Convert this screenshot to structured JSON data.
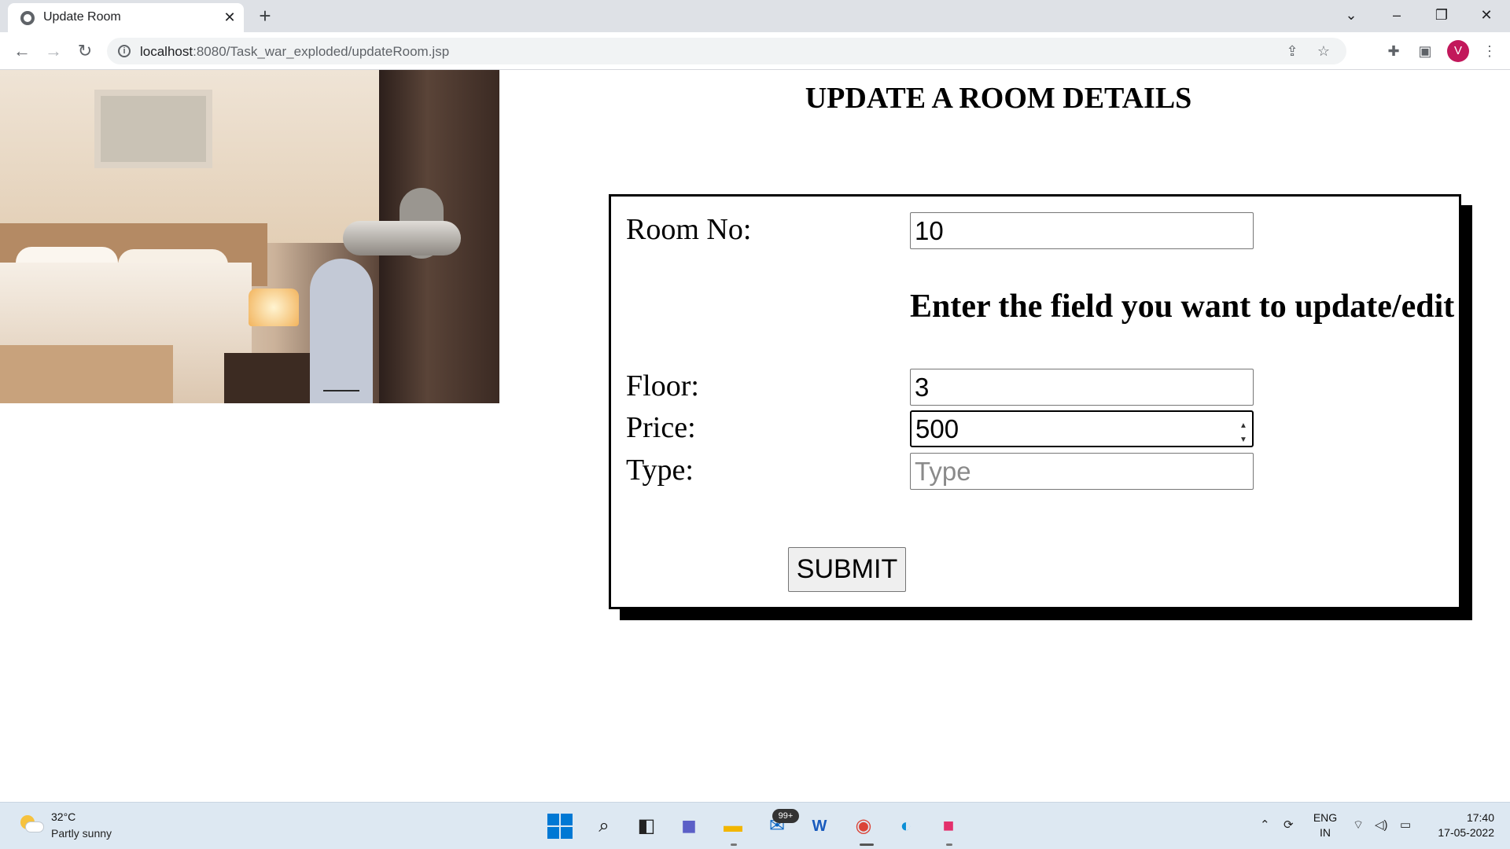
{
  "browser": {
    "tab_title": "Update Room",
    "tab_close": "✕",
    "new_tab": "+",
    "url_host": "localhost",
    "url_rest": ":8080/Task_war_exploded/updateRoom.jsp",
    "profile_initial": "V",
    "icons": [
      "globe-icon",
      "back-icon",
      "forward-icon",
      "reload-icon",
      "info-icon",
      "share-icon",
      "star-icon",
      "extensions-icon",
      "side-panel-icon",
      "menu-icon"
    ]
  },
  "page": {
    "title": "UPDATE A ROOM DETAILS",
    "image_tag_number": "206",
    "room_no_label": "Room No:",
    "room_no_value": "10",
    "hint": "Enter the field you want to update/edit",
    "floor_label": "Floor:",
    "floor_value": "3",
    "price_label": "Price:",
    "price_value": "500",
    "type_label": "Type:",
    "type_placeholder": "Type",
    "submit_label": "SUBMIT"
  },
  "taskbar": {
    "temperature": "32°C",
    "weather": "Partly sunny",
    "mail_badge": "99+",
    "lang_line1": "ENG",
    "lang_line2": "IN",
    "time": "17:40",
    "date": "17-05-2022",
    "colors": {
      "accent": "#0078d4",
      "taskbar_bg": "#dde8f2"
    }
  }
}
